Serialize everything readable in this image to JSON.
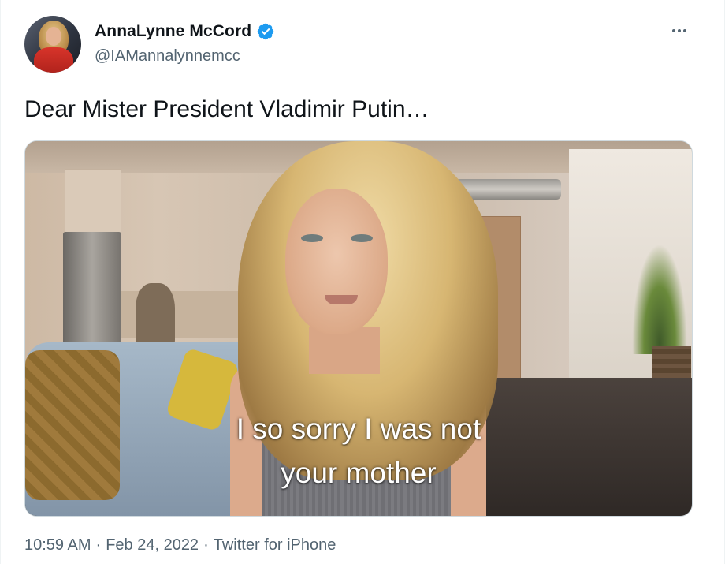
{
  "author": {
    "display_name": "AnnaLynne McCord",
    "handle": "@IAMannalynnemcc",
    "verified": true,
    "verified_color": "#1d9bf0",
    "avatar_icon": "profile-photo"
  },
  "more_icon": "more-horizontal-icon",
  "tweet": {
    "text": "Dear Mister President Vladimir Putin…"
  },
  "media": {
    "type": "video",
    "subtitle_line1": "I so sorry I was not",
    "subtitle_line2": "your mother"
  },
  "meta": {
    "time": "10:59 AM",
    "separator": "·",
    "date": "Feb 24, 2022",
    "source": "Twitter for iPhone"
  },
  "colors": {
    "text_primary": "#0f1419",
    "text_secondary": "#536471",
    "border": "#cfd9de"
  }
}
